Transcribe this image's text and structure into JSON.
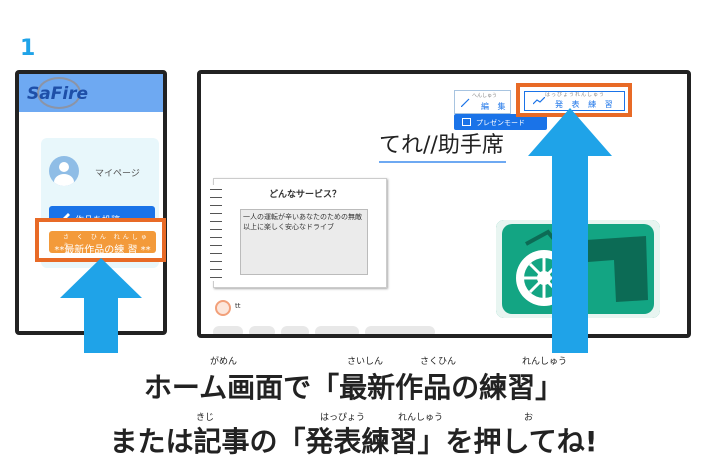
{
  "step_number": "1",
  "phone": {
    "logo": "SaFire",
    "mypage_label": "マイページ",
    "post_button_label": "作品を投稿",
    "practice_ruby": "さ く ひん れんしゅう",
    "practice_button_label": "**最新作品の練 習 **"
  },
  "article": {
    "edit_ruby": "へんしゅう",
    "edit_label": "編 集",
    "present_ruby": "はっぴょうれんしゅう",
    "present_label": "発 表 練 習",
    "presentation_mode_label": "プレゼンモード",
    "title": "てれ//助手席",
    "notebook_title": "どんなサービス？",
    "notebook_text": "一人の運転が辛いあなたのための無敵以上に楽しく安心なドライブ",
    "author_name": "tt"
  },
  "caption": {
    "line1": "ホーム画面で「最新作品の練習」",
    "line1_ruby": [
      "がめん",
      "さいしん",
      "さくひん",
      "れんしゅう"
    ],
    "line2": "または記事の「発表練習」を押してね!",
    "line2_ruby": [
      "きじ",
      "はっぴょう",
      "れんしゅう",
      "お"
    ]
  },
  "colors": {
    "accent_blue": "#1fa3e8",
    "highlight_orange": "#e86a26",
    "practice_button": "#f39a3a",
    "header_blue": "#6ea9f2"
  }
}
